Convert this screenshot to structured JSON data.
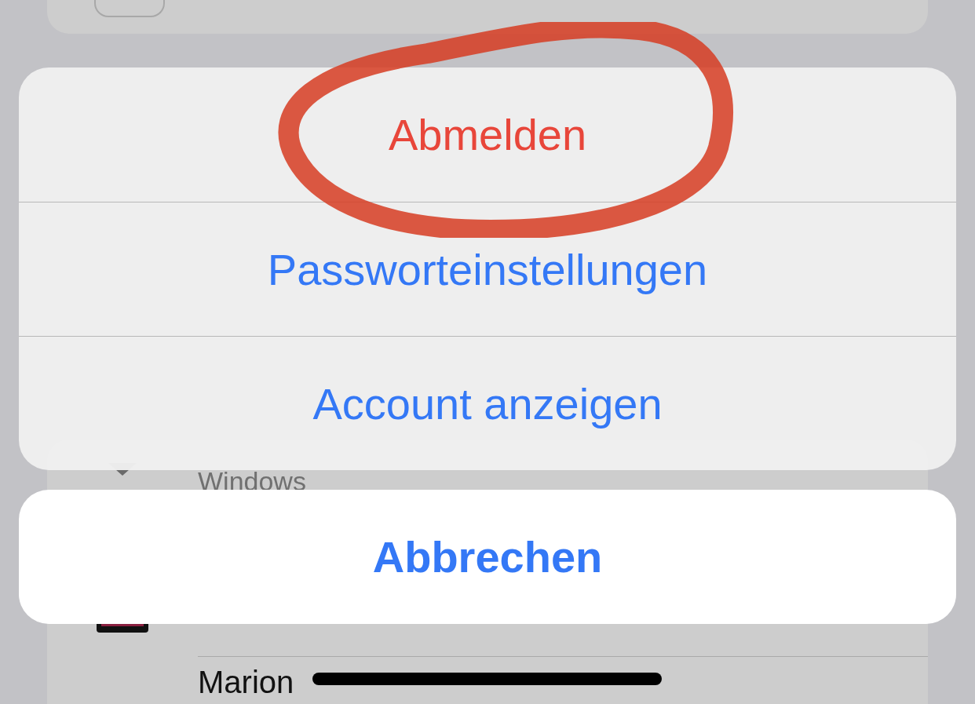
{
  "background_list": {
    "items": [
      {
        "subtitle": "Windows",
        "kind": "laptop"
      },
      {
        "kind": "tablet"
      },
      {
        "title": "Marion",
        "kind": "person"
      }
    ]
  },
  "action_sheet": {
    "actions": [
      {
        "label": "Abmelden",
        "kind": "destructive",
        "highlighted": true
      },
      {
        "label": "Passworteinstellungen",
        "kind": "default",
        "highlighted": false
      },
      {
        "label": "Account anzeigen",
        "kind": "default",
        "highlighted": false
      }
    ],
    "cancel": {
      "label": "Abbrechen"
    }
  }
}
